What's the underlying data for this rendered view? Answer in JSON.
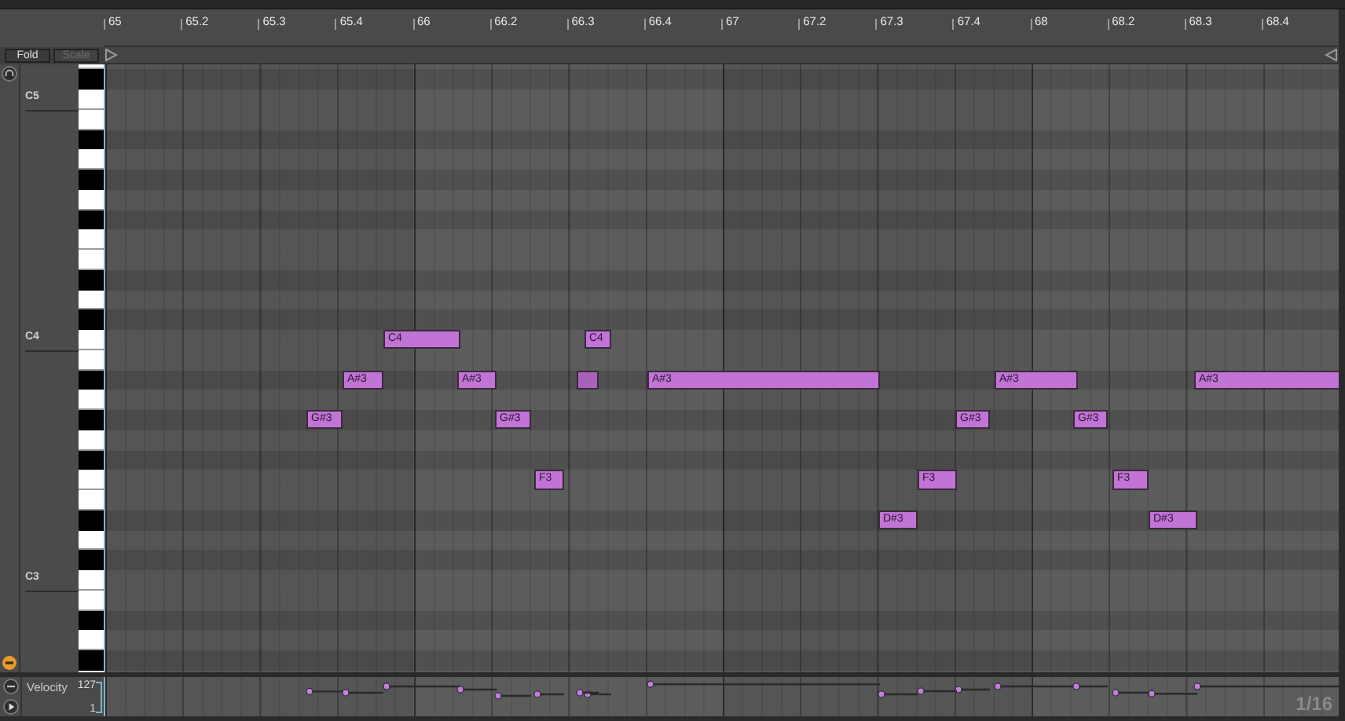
{
  "ruler": {
    "labels": [
      "65",
      "65.2",
      "65.3",
      "65.4",
      "66",
      "66.2",
      "66.3",
      "66.4",
      "67",
      "67.2",
      "67.3",
      "67.4",
      "68",
      "68.2",
      "68.3",
      "68.4"
    ]
  },
  "buttons": [
    {
      "label": "Fold",
      "disabled": false
    },
    {
      "label": "Scale",
      "disabled": true
    }
  ],
  "keyboard": {
    "octave_labels": [
      "C5",
      "C4",
      "C3"
    ]
  },
  "notes": [
    {
      "label": "C4"
    },
    {
      "label": "C4"
    },
    {
      "label": "A#3"
    },
    {
      "label": "A#3"
    },
    {
      "kind": "unlabeled"
    },
    {
      "label": "A#3"
    },
    {
      "label": "A#3"
    },
    {
      "label": "A#3"
    },
    {
      "label": "G#3"
    },
    {
      "label": "G#3"
    },
    {
      "label": "G#3"
    },
    {
      "label": "G#3"
    },
    {
      "label": "F3"
    },
    {
      "label": "F3"
    },
    {
      "label": "F3"
    },
    {
      "label": "D#3"
    },
    {
      "label": "D#3"
    }
  ],
  "velocity_lane": {
    "title": "Velocity",
    "max": "127",
    "min": "1"
  },
  "grid_size": "1/16"
}
